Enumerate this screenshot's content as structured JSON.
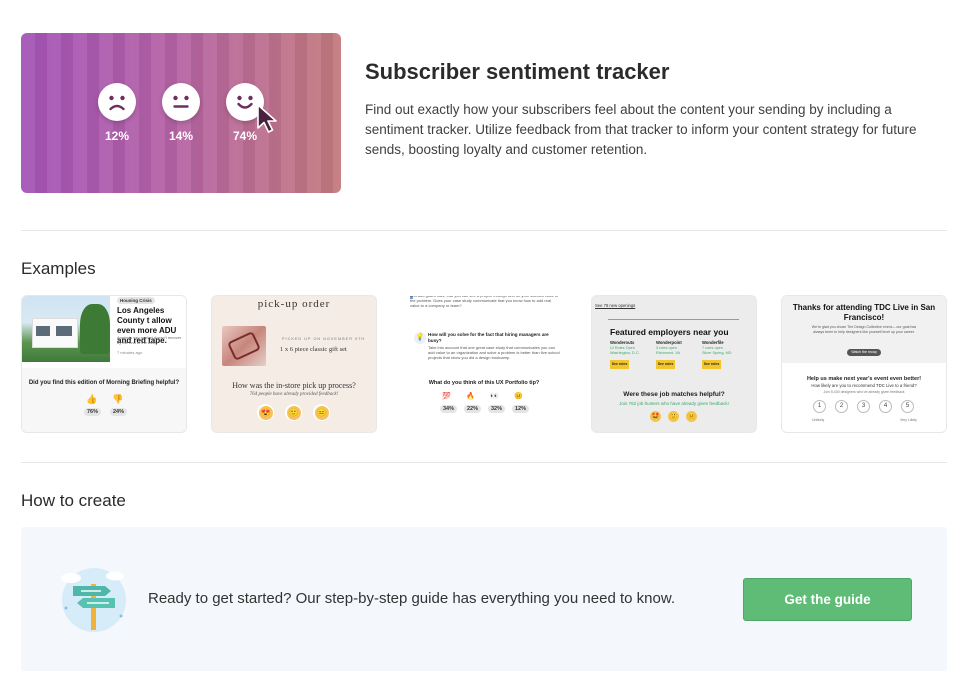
{
  "hero": {
    "title": "Subscriber sentiment tracker",
    "description": "Find out exactly how your subscribers feel about the content your sending by including a sentiment tracker. Utilize feedback from that tracker to inform your content strategy for future sends, boosting loyalty and customer retention.",
    "faces": [
      {
        "icon": "sad-face-icon",
        "percent": "12%"
      },
      {
        "icon": "neutral-face-icon",
        "percent": "14%"
      },
      {
        "icon": "happy-face-icon",
        "percent": "74%"
      }
    ],
    "colors": {
      "gradient_start": "#a353b7",
      "gradient_end": "#c27a7c"
    }
  },
  "examples": {
    "heading": "Examples",
    "cards": [
      {
        "tag": "Housing Crisis",
        "headline": "Los Angeles County t allow even more ADU and red tape.",
        "blurb": "Analysts say market doesn't recover by the end of the week.",
        "time": "7 minutes ago",
        "question": "Did you find this edition of Morning Briefing helpful?",
        "votes": [
          "76%",
          "24%"
        ]
      },
      {
        "title": "pick-up order",
        "meta": "PICKED UP ON NOVEMBER 9TH",
        "item": "1 x 6 piece classic gift set",
        "question": "How was the in-store pick up process?",
        "sub": "764 people have already provided feedback!"
      },
      {
        "intro": "and add guard rails, that you can see a project through and do your solution back to the problem. Does your case study communicate that you know how to add real value to a company or team?",
        "subq": "How will you solve for the fact that hiring managers are busy?",
        "body": "Take into account that one great case study that communicates you can add value to an organization and solve a problem is better than five school projects that show you did a design bootcamp.",
        "question": "What do you think of this UX Portfolio tip?",
        "votes": [
          "34%",
          "22%",
          "32%",
          "12%"
        ]
      },
      {
        "link": "See 78 new openings",
        "title": "Featured employers near you",
        "jobs": [
          {
            "name": "Wonderoutx",
            "role": "UI Roles Open",
            "place": "Washington, D.C."
          },
          {
            "name": "Wonderpoint",
            "role": "3 roles open",
            "place": "Richmond, VA"
          },
          {
            "name": "Wonderfile",
            "role": "7 roles open",
            "place": "Silver Spring, MD"
          }
        ],
        "button": "See roles",
        "question": "Were these job matches helpful?",
        "sub": "Join 762 job hunters who have already given feedback!"
      },
      {
        "title": "Thanks for attending TDC Live in San Francisco!",
        "blurb": "We're glad you chose The Design Collective event— our goal has always been to help designers like yourself level up your career.",
        "button": "Watch the recap",
        "question": "Help us make next year's event even better!",
        "subq": "How likely are you to recommend TDC Live to a friend?",
        "note": "Join 5,430 designers who've already given feedback",
        "scale": [
          "1",
          "2",
          "3",
          "4",
          "5"
        ],
        "low": "Unlikely",
        "high": "Very Likely"
      }
    ]
  },
  "how_to": {
    "heading": "How to create",
    "text": "Ready to get started? Our step-by-step guide has everything you need to know.",
    "button": "Get the guide",
    "colors": {
      "button": "#5fbc76",
      "panel": "#f4f7fb"
    }
  }
}
